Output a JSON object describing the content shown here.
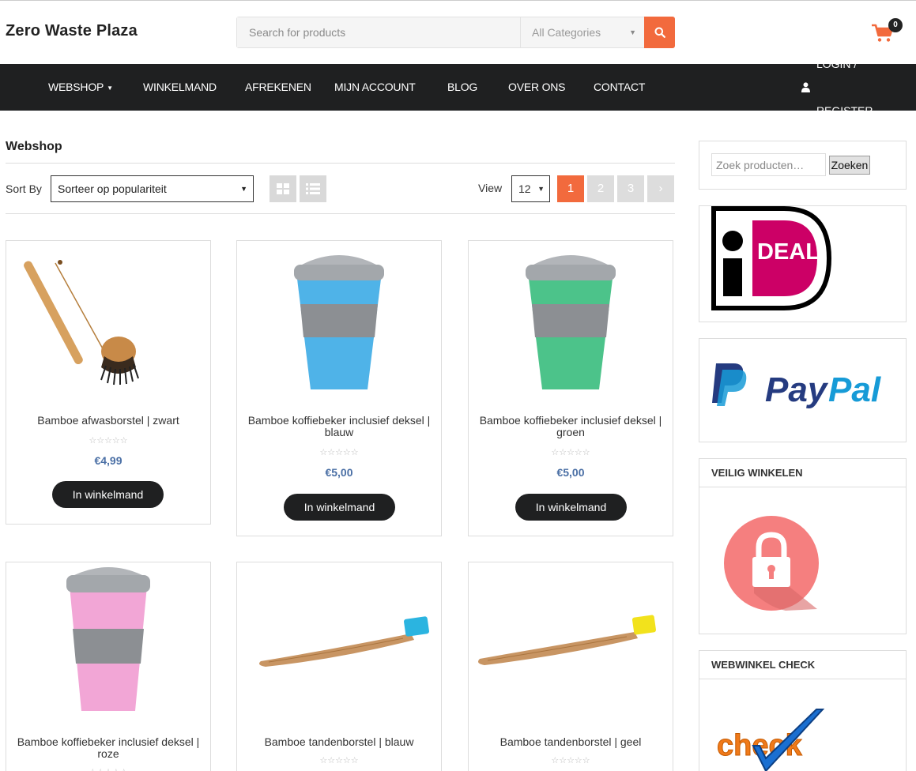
{
  "site": {
    "title": "Zero Waste Plaza",
    "search_placeholder": "Search for products",
    "category_selected": "All Categories",
    "cart_count": "0",
    "accent_color": "#f26a3d"
  },
  "nav": {
    "items": [
      {
        "label": "WEBSHOP",
        "has_caret": true
      },
      {
        "label": "WINKELMAND"
      },
      {
        "label": "AFREKENEN"
      },
      {
        "label": "MIJN ACCOUNT"
      },
      {
        "label": "BLOG"
      },
      {
        "label": "OVER ONS"
      },
      {
        "label": "CONTACT"
      }
    ],
    "login": "LOGIN / REGISTER"
  },
  "shop": {
    "title": "Webshop",
    "sort_label": "Sort By",
    "sort_selected": "Sorteer op populariteit",
    "view_label": "View",
    "view_selected": "12",
    "pages": [
      "1",
      "2",
      "3"
    ],
    "next_icon": "chevron-right-icon",
    "add_to_cart_label": "In winkelmand",
    "products": [
      {
        "name": "Bamboe afwasborstel | zwart",
        "price": "€4,99",
        "rating": "☆☆☆☆☆"
      },
      {
        "name": "Bamboe koffiebeker inclusief deksel | blauw",
        "price": "€5,00",
        "rating": "☆☆☆☆☆"
      },
      {
        "name": "Bamboe koffiebeker inclusief deksel | groen",
        "price": "€5,00",
        "rating": "☆☆☆☆☆"
      },
      {
        "name": "Bamboe koffiebeker inclusief deksel | roze",
        "rating": "☆☆☆☆☆"
      },
      {
        "name": "Bamboe tandenborstel | blauw",
        "rating": "☆☆☆☆☆"
      },
      {
        "name": "Bamboe tandenborstel | geel",
        "rating": "☆☆☆☆☆"
      }
    ]
  },
  "sidebar": {
    "search_placeholder": "Zoek producten…",
    "search_button": "Zoeken",
    "ideal_logo": "iDEAL",
    "paypal_logo": "PayPal",
    "veilig_title": "VEILIG WINKELEN",
    "webwinkel_title": "WEBWINKEL CHECK",
    "check_logo": "check"
  }
}
